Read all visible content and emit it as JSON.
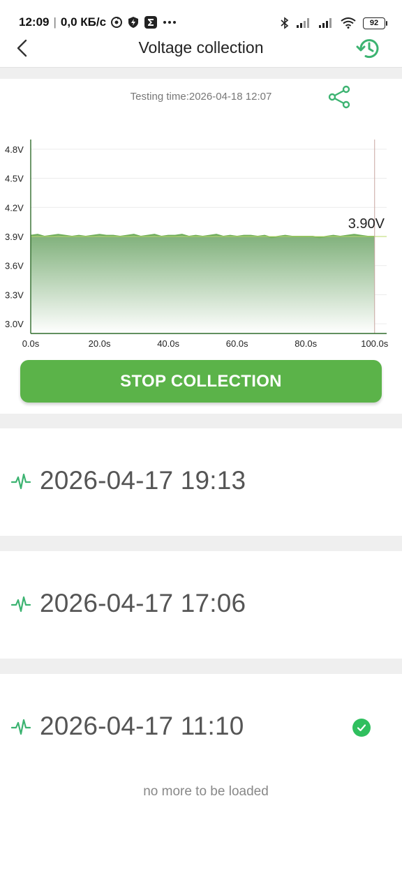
{
  "status_bar": {
    "time": "12:09",
    "network_speed": "0,0 КБ/с",
    "battery": "92"
  },
  "header": {
    "title": "Voltage collection"
  },
  "session": {
    "testing_time": "Testing time:2026-04-18 12:07"
  },
  "chart_data": {
    "type": "area",
    "y_ticks": [
      "4.8V",
      "4.5V",
      "4.2V",
      "3.9V",
      "3.6V",
      "3.3V",
      "3.0V"
    ],
    "x_ticks": [
      "0.0s",
      "20.0s",
      "40.0s",
      "60.0s",
      "80.0s",
      "100.0s"
    ],
    "ylim": [
      2.9,
      4.9
    ],
    "xlim": [
      0,
      100
    ],
    "current_value_label": "3.90V",
    "current_value": 3.9,
    "x": [
      0,
      2,
      4,
      6,
      8,
      10,
      12,
      14,
      16,
      18,
      20,
      22,
      24,
      26,
      28,
      30,
      32,
      34,
      36,
      38,
      40,
      42,
      44,
      46,
      48,
      50,
      52,
      54,
      56,
      58,
      60,
      62,
      64,
      66,
      68,
      70,
      72,
      74,
      76,
      78,
      80,
      82,
      84,
      86,
      88,
      90,
      92,
      94,
      96,
      98
    ],
    "values": [
      3.91,
      3.92,
      3.9,
      3.91,
      3.92,
      3.91,
      3.9,
      3.91,
      3.9,
      3.91,
      3.92,
      3.91,
      3.91,
      3.9,
      3.91,
      3.92,
      3.9,
      3.91,
      3.92,
      3.9,
      3.91,
      3.91,
      3.92,
      3.9,
      3.91,
      3.9,
      3.91,
      3.92,
      3.9,
      3.91,
      3.9,
      3.91,
      3.91,
      3.9,
      3.91,
      3.89,
      3.9,
      3.91,
      3.9,
      3.9,
      3.9,
      3.9,
      3.89,
      3.9,
      3.91,
      3.9,
      3.91,
      3.92,
      3.91,
      3.9
    ],
    "grid": true,
    "colors": {
      "line": "#6fae5a",
      "fill_top": "#7fb07a",
      "fill_bottom": "#ffffff",
      "axis": "#2f6b2a",
      "marker_line": "#c8a6a0"
    }
  },
  "controls": {
    "stop_label": "STOP COLLECTION"
  },
  "records": [
    {
      "datetime": "2026-04-17 19:13",
      "checked": false
    },
    {
      "datetime": "2026-04-17 17:06",
      "checked": false
    },
    {
      "datetime": "2026-04-17 11:10",
      "checked": true
    }
  ],
  "footer": {
    "no_more": "no more to be loaded"
  },
  "icons": {
    "back": "back-arrow-icon",
    "history": "history-icon",
    "share": "share-icon",
    "record": "waveform-icon",
    "check": "check-icon"
  },
  "colors": {
    "accent": "#5bb349",
    "accent_icon": "#3cb371",
    "check": "#2fbf5e",
    "gap_bg": "#efefef"
  }
}
